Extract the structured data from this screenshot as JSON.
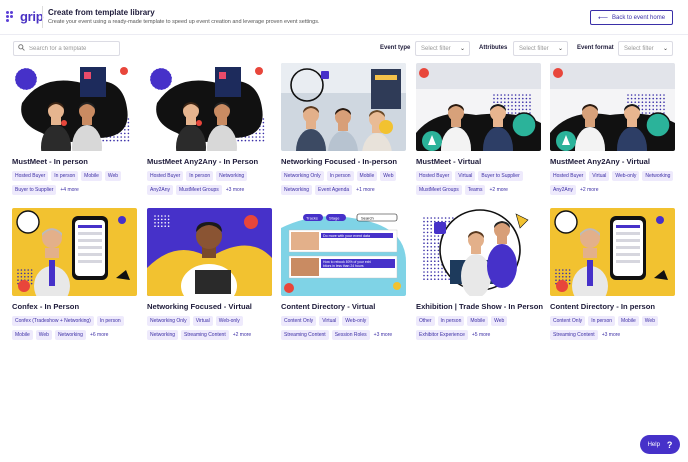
{
  "brand": {
    "logo_text": "grip",
    "primary_color": "#4631c9",
    "tag_bg": "#eeeafc"
  },
  "header": {
    "title": "Create from template library",
    "subtitle": "Create your event using a ready-made template to speed up event creation and leverage proven event settings.",
    "back_label": "Back to event home",
    "back_icon": "arrow-left-icon"
  },
  "filters": {
    "search_placeholder": "Search for a template",
    "event_type_label": "Event type",
    "event_type_value": "Select filter",
    "attributes_label": "Attributes",
    "attributes_value": "Select filter",
    "event_format_label": "Event format",
    "event_format_value": "Select filter"
  },
  "templates": [
    {
      "title": "MustMeet - In person",
      "art": "event",
      "tags": [
        "Hosted Buyer",
        "In person",
        "Mobile",
        "Web",
        "Buyer to Supplier"
      ],
      "more": "+4 more"
    },
    {
      "title": "MustMeet Any2Any - In Person",
      "art": "event",
      "tags": [
        "Hosted Buyer",
        "In person",
        "Networking",
        "Any2Any",
        "MustMeet Groups"
      ],
      "more": "+3 more"
    },
    {
      "title": "Networking Focused - In-person",
      "art": "crowd",
      "tags": [
        "Networking Only",
        "In person",
        "Mobile",
        "Web",
        "Networking",
        "Event Agenda"
      ],
      "more": "+1 more"
    },
    {
      "title": "MustMeet - Virtual",
      "art": "virtual",
      "tags": [
        "Hosted Buyer",
        "Virtual",
        "Buyer to Supplier",
        "MustMeet Groups",
        "Teams"
      ],
      "more": "+2 more"
    },
    {
      "title": "MustMeet Any2Any - Virtual",
      "art": "virtual",
      "tags": [
        "Hosted Buyer",
        "Virtual",
        "Web-only",
        "Networking",
        "Any2Any"
      ],
      "more": "+2 more"
    },
    {
      "title": "Confex - In Person",
      "art": "phone",
      "tags": [
        "Confex (Tradeshow + Networking)",
        "In person",
        "Mobile",
        "Web",
        "Networking"
      ],
      "more": "+6 more"
    },
    {
      "title": "Networking Focused - Virtual",
      "art": "laptop",
      "tags": [
        "Networking Only",
        "Virtual",
        "Web-only",
        "Networking",
        "Streaming Content"
      ],
      "more": "+2 more"
    },
    {
      "title": "Content Directory - Virtual",
      "art": "content",
      "tags": [
        "Content Only",
        "Virtual",
        "Web-only",
        "Streaming Content",
        "Session Roles"
      ],
      "more": "+3 more"
    },
    {
      "title": "Exhibition | Trade Show - In Person",
      "art": "expo",
      "tags": [
        "Other",
        "In person",
        "Mobile",
        "Web",
        "Exhibitor Experience"
      ],
      "more": "+5 more"
    },
    {
      "title": "Content Directory - In person",
      "art": "phone",
      "tags": [
        "Content Only",
        "In person",
        "Mobile",
        "Web",
        "Streaming Content"
      ],
      "more": "+3 more"
    }
  ],
  "content_art": {
    "pill_1": "Tracks",
    "pill_2": "Stage",
    "search": "Search",
    "headline_1": "Do more with your event data",
    "headline_2": "How to rebook 80% of your exhibitors in less than 24 hours"
  },
  "help": {
    "label": "Help",
    "icon": "question-icon"
  }
}
